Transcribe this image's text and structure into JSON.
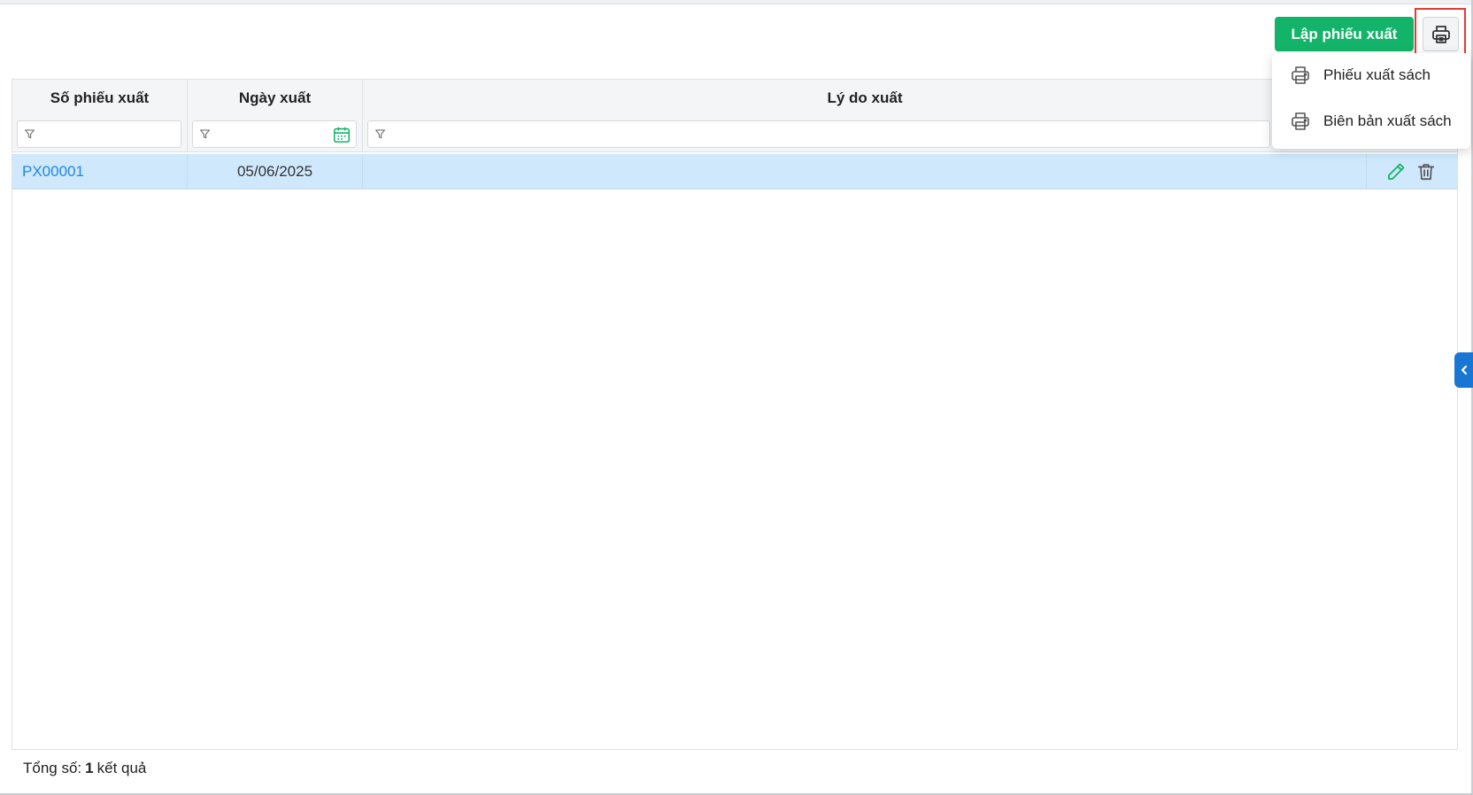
{
  "toolbar": {
    "create_label": "Lập phiếu xuất",
    "print_icon": "printer-icon",
    "accent_color": "#13b46a",
    "highlight_color": "#e53935"
  },
  "print_menu": {
    "items": [
      {
        "label": "Phiếu xuất sách",
        "icon": "printer-icon"
      },
      {
        "label": "Biên bản xuất sách",
        "icon": "printer-icon"
      }
    ]
  },
  "table": {
    "columns": [
      {
        "title": "Số phiếu xuất",
        "filter_icon": "filter-icon",
        "filter_value": ""
      },
      {
        "title": "Ngày xuất",
        "filter_icon": "filter-icon",
        "filter_value": "",
        "picker_icon": "calendar-icon"
      },
      {
        "title": "Lý do xuất",
        "filter_icon": "filter-icon",
        "filter_value": ""
      }
    ],
    "rows": [
      {
        "id": "PX00001",
        "date": "05/06/2025",
        "reason": "",
        "actions": [
          "edit-icon",
          "trash-icon"
        ]
      }
    ],
    "selected_row_color": "#cfe8fc",
    "link_color": "#1e88e5"
  },
  "side_panel": {
    "toggle_icon": "chevron-left-icon",
    "color": "#1976d2"
  },
  "footer": {
    "total_label": "Tổng số:",
    "total_count": "1",
    "result_label": "kết quả"
  }
}
